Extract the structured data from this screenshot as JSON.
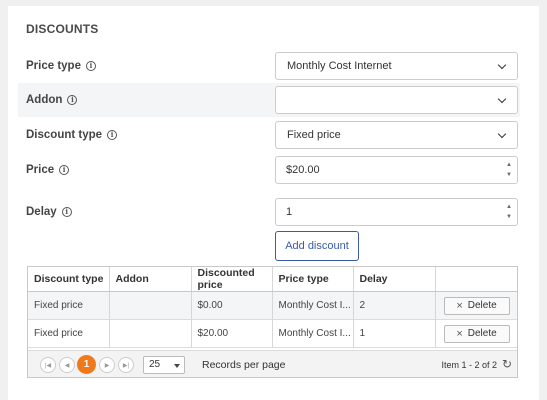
{
  "section": {
    "title": "DISCOUNTS"
  },
  "form": {
    "price_type": {
      "label": "Price type",
      "value": "Monthly Cost Internet"
    },
    "addon": {
      "label": "Addon",
      "value": ""
    },
    "discount_type": {
      "label": "Discount type",
      "value": "Fixed price"
    },
    "price": {
      "label": "Price",
      "value": "$20.00"
    },
    "delay": {
      "label": "Delay",
      "value": "1"
    },
    "add_button": "Add discount"
  },
  "table": {
    "columns": [
      "Discount type",
      "Addon",
      "Discounted price",
      "Price type",
      "Delay",
      ""
    ],
    "rows": [
      {
        "discount_type": "Fixed price",
        "addon": "",
        "discounted_price": "$0.00",
        "price_type": "Monthly Cost I...",
        "delay": "2",
        "action": "Delete"
      },
      {
        "discount_type": "Fixed price",
        "addon": "",
        "discounted_price": "$20.00",
        "price_type": "Monthly Cost I...",
        "delay": "1",
        "action": "Delete"
      }
    ]
  },
  "pager": {
    "current_page": "1",
    "page_size": "25",
    "records_label": "Records per page",
    "info": "Item 1 - 2 of 2",
    "icons": [
      "first-page-icon",
      "prev-page-icon",
      "next-page-icon",
      "last-page-icon",
      "refresh-icon"
    ]
  },
  "colors": {
    "accent": "#3a5ca8",
    "pager_current": "#f07a1a"
  }
}
